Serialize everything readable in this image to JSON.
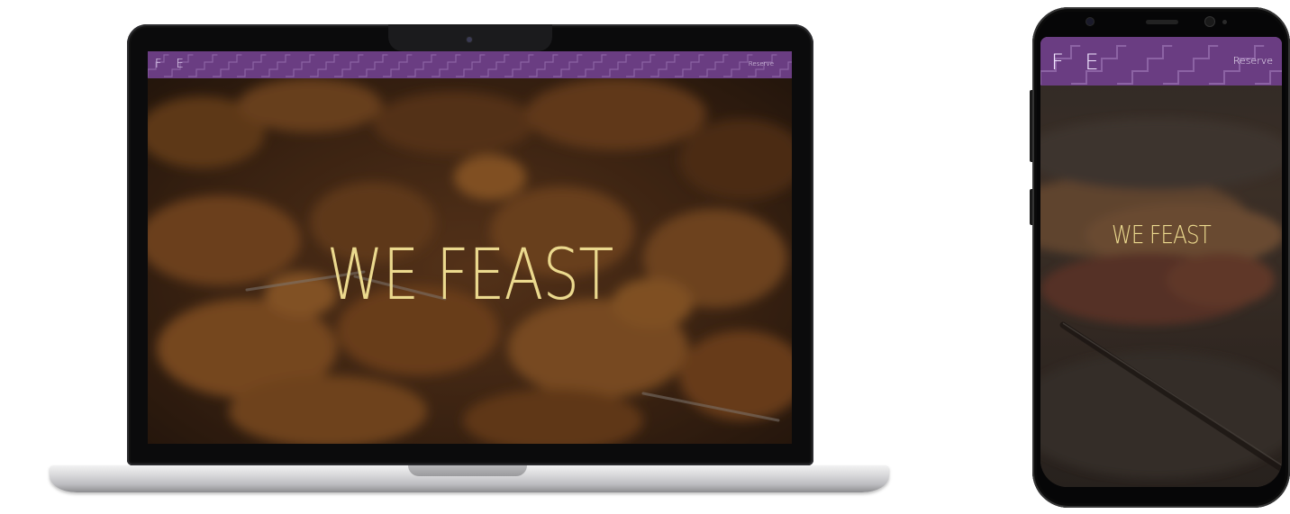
{
  "desktop": {
    "logo": "F E",
    "nav_reserve": "Reserve",
    "hero_title": "WE FEAST"
  },
  "mobile": {
    "logo": "F E",
    "nav_reserve": "Reserve",
    "hero_title": "WE FEAST"
  },
  "colors": {
    "header_purple": "#6a3d82",
    "header_pattern_line": "#8c63a4",
    "title_gold": "#ebd98e",
    "device_black": "#0b0b0c",
    "laptop_silver": "#d9d9db"
  },
  "icons": {
    "header_pattern": "stair-step-pattern",
    "laptop_camera": "camera-icon",
    "phone_camera": "camera-icon"
  }
}
